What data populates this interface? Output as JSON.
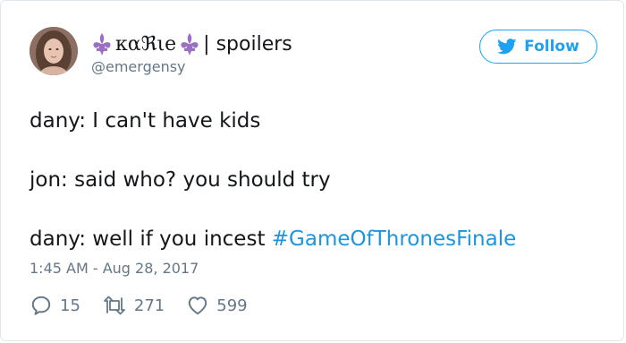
{
  "user": {
    "display_name": "καℜιe",
    "display_suffix": "| spoilers",
    "handle": "@emergensy"
  },
  "follow_label": "Follow",
  "tweet": {
    "lines": [
      "dany: I can't have kids",
      "jon: said who? you should try",
      "dany: well if you incest "
    ],
    "hashtag": "#GameOfThronesFinale"
  },
  "timestamp": "1:45 AM - Aug 28, 2017",
  "actions": {
    "replies": "15",
    "retweets": "271",
    "likes": "599"
  },
  "colors": {
    "accent": "#1da1f2",
    "hashtag": "#1b95e0",
    "muted": "#657786",
    "fleur": "#9b6fc4"
  }
}
